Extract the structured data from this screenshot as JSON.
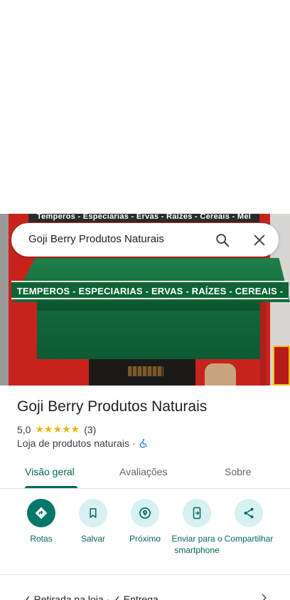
{
  "search": {
    "query": "Goji Berry Produtos Naturais"
  },
  "photo": {
    "top_sign": "Temperos - Especiarias - Ervas - Raízes - Cereais - Mel",
    "awning_text": "TEMPEROS - ESPECIARIAS - ERVAS - RAÍZES - CEREAIS - MEL"
  },
  "place": {
    "title": "Goji Berry Produtos Naturais",
    "rating": "5,0",
    "stars": "★★★★★",
    "review_count": "(3)",
    "category": "Loja de produtos naturais ·"
  },
  "tabs": [
    {
      "label": "Visão geral",
      "active": true
    },
    {
      "label": "Avaliações",
      "active": false
    },
    {
      "label": "Sobre",
      "active": false
    }
  ],
  "actions": [
    {
      "label": "Rotas",
      "icon": "directions-icon"
    },
    {
      "label": "Salvar",
      "icon": "bookmark-icon"
    },
    {
      "label": "Próximo",
      "icon": "nearby-icon"
    },
    {
      "label": "Enviar para o smartphone",
      "icon": "send-to-phone-icon"
    },
    {
      "label": "Compartilhar",
      "icon": "share-icon"
    }
  ],
  "bottom_row": {
    "text": "✓ Retirada na loja · ✓ Entrega"
  },
  "colors": {
    "accent": "#00695c",
    "primary_button": "#00796b",
    "action_circle": "#d7f0f2",
    "stars": "#f4b400"
  }
}
